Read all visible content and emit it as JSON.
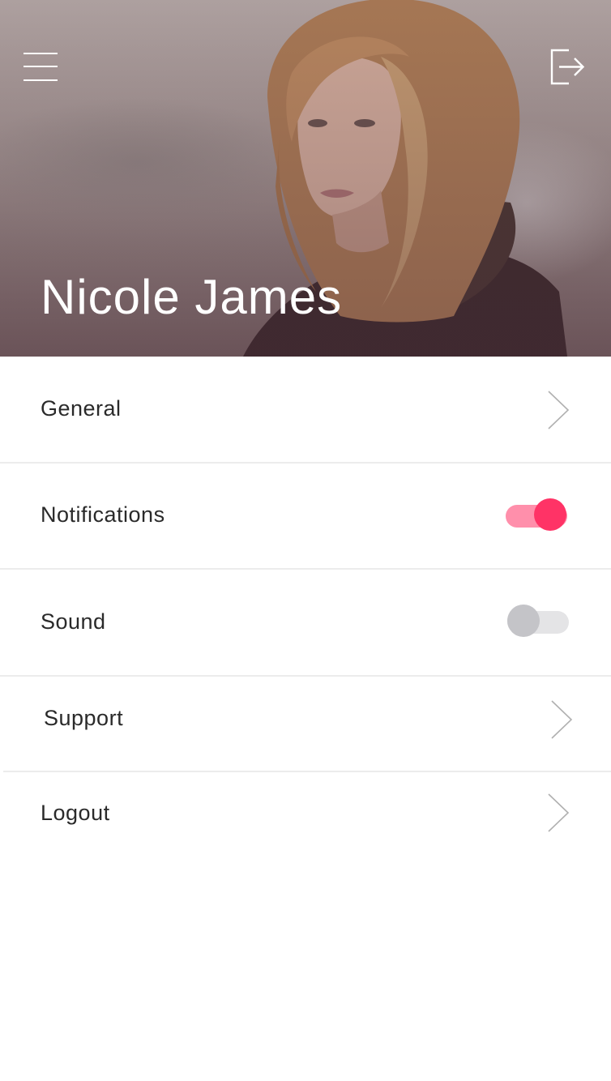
{
  "header": {
    "profile_name": "Nicole James",
    "menu_icon": "hamburger-menu-icon",
    "exit_icon": "logout-exit-icon"
  },
  "settings": {
    "items": [
      {
        "label": "General",
        "control": "chevron-right-icon"
      },
      {
        "label": "Notifications",
        "control": "toggle",
        "on": true
      },
      {
        "label": "Sound",
        "control": "toggle",
        "on": false
      },
      {
        "label": "Support",
        "control": "chevron-right-icon"
      },
      {
        "label": "Logout",
        "control": "chevron-right-icon"
      }
    ]
  },
  "colors": {
    "accent": "#ff3366",
    "accent_track": "#ff8fab",
    "toggle_off_knob": "#c4c4c8",
    "toggle_off_track": "#e4e4e6",
    "divider": "#ececec",
    "chevron": "#b0b0b0",
    "text": "#2a2a2a"
  }
}
